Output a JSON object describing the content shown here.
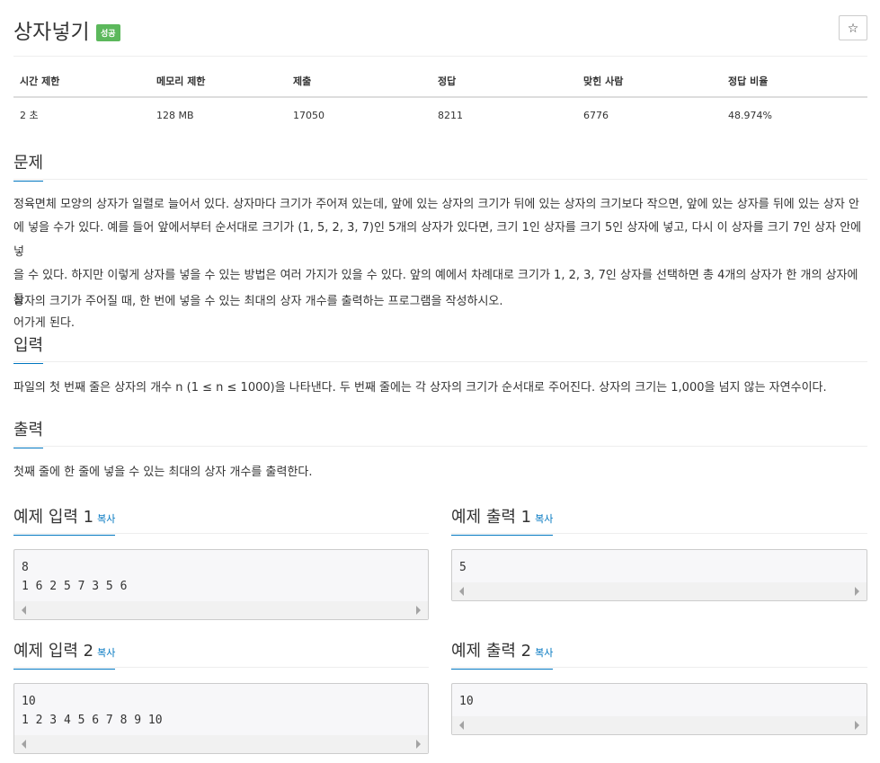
{
  "header": {
    "title": "상자넣기",
    "badge": "성공",
    "star": "☆"
  },
  "info_table": {
    "headers": [
      "시간 제한",
      "메모리 제한",
      "제출",
      "정답",
      "맞힌 사람",
      "정답 비율"
    ],
    "values": [
      "2 초",
      "128 MB",
      "17050",
      "8211",
      "6776",
      "48.974%"
    ]
  },
  "problem": {
    "heading": "문제",
    "line1": "정육면체 모양의 상자가 일렬로 늘어서 있다. 상자마다 크기가 주어져 있는데, 앞에 있는 상자의 크기가 뒤에 있는 상자의 크기보다 작으면, 앞에 있는 상자를 뒤에 있는 상자 안",
    "line2": "에 넣을 수가 있다. 예를 들어 앞에서부터 순서대로 크기가 (1, 5, 2, 3, 7)인 5개의 상자가 있다면, 크기 1인 상자를 크기 5인 상자에 넣고, 다시 이 상자를 크기 7인 상자 안에 넣",
    "line3": "을 수 있다. 하지만 이렇게 상자를 넣을 수 있는 방법은 여러 가지가 있을 수 있다. 앞의 예에서 차례대로 크기가 1, 2, 3, 7인 상자를 선택하면 총 4개의 상자가 한 개의 상자에 들",
    "line4": "어가게 된다.",
    "para2": "상자의 크기가 주어질 때, 한 번에 넣을 수 있는 최대의 상자 개수를 출력하는 프로그램을 작성하시오."
  },
  "input": {
    "heading": "입력",
    "text": "파일의 첫 번째 줄은 상자의 개수 n (1 ≤ n ≤ 1000)을 나타낸다. 두 번째 줄에는 각 상자의 크기가 순서대로 주어진다. 상자의 크기는 1,000을 넘지 않는 자연수이다."
  },
  "output": {
    "heading": "출력",
    "text": "첫째 줄에 한 줄에 넣을 수 있는 최대의 상자 개수를 출력한다."
  },
  "samples": {
    "copy_label": "복사",
    "in1": {
      "heading": "예제 입력 1",
      "line1": "8",
      "line2": "1 6 2 5 7 3 5 6"
    },
    "out1": {
      "heading": "예제 출력 1",
      "line1": "5"
    },
    "in2": {
      "heading": "예제 입력 2",
      "line1": "10",
      "line2": "1 2 3 4 5 6 7 8 9 10"
    },
    "out2": {
      "heading": "예제 출력 2",
      "line1": "10"
    }
  }
}
